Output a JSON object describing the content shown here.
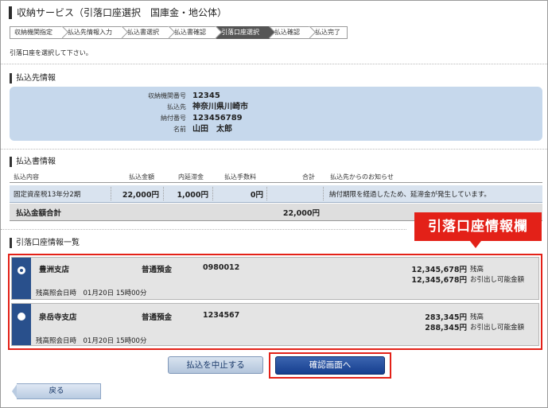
{
  "page": {
    "title": "収納サービス（引落口座選択　国庫金・地公体）",
    "instruction": "引落口座を選択して下さい。"
  },
  "steps": [
    {
      "label": "収納機関指定",
      "active": false
    },
    {
      "label": "払込先情報入力",
      "active": false
    },
    {
      "label": "払込書選択",
      "active": false
    },
    {
      "label": "払込書確認",
      "active": false
    },
    {
      "label": "引落口座選択",
      "active": true
    },
    {
      "label": "払込確認",
      "active": false
    },
    {
      "label": "払込完了",
      "active": false
    }
  ],
  "payee": {
    "heading": "払込先情報",
    "rows": [
      {
        "label": "収納機関番号",
        "value": "12345"
      },
      {
        "label": "払込先",
        "value": "神奈川県川崎市"
      },
      {
        "label": "納付番号",
        "value": "123456789"
      },
      {
        "label": "名前",
        "value": "山田　太郎"
      }
    ]
  },
  "invoice": {
    "heading": "払込書情報",
    "columns": {
      "content": "払込内容",
      "amount": "払込金額",
      "arrears": "内延滞金",
      "fee": "払込手数料",
      "total": "合計",
      "notice": "払込先からのお知らせ"
    },
    "row": {
      "content": "固定資産税13年分2期",
      "amount": "22,000円",
      "arrears": "1,000円",
      "fee": "0円",
      "total": "",
      "notice": "納付期限を経過したため、延滞金が発生しています。"
    },
    "total_label": "払込金額合計",
    "total_value": "22,000円"
  },
  "accounts": {
    "heading": "引落口座情報一覧",
    "callout": "引落口座情報欄",
    "items": [
      {
        "branch": "豊洲支店",
        "type": "普通預金",
        "number": "0980012",
        "balance": "12,345,678円",
        "balance_label": "残高",
        "available": "12,345,678円",
        "available_label": "お引出し可能金額",
        "inquiry": "残高照会日時　01月20日 15時00分",
        "selected": true
      },
      {
        "branch": "泉岳寺支店",
        "type": "普通預金",
        "number": "1234567",
        "balance": "283,345円",
        "balance_label": "残高",
        "available": "288,345円",
        "available_label": "お引出し可能金額",
        "inquiry": "残高照会日時　01月20日 15時00分",
        "selected": false
      }
    ]
  },
  "buttons": {
    "cancel": "払込を中止する",
    "confirm": "確認画面へ",
    "back": "戻る"
  },
  "colors": {
    "highlight_red": "#e32118",
    "navy": "#29508c",
    "payee_bg": "#c6d8ec"
  }
}
